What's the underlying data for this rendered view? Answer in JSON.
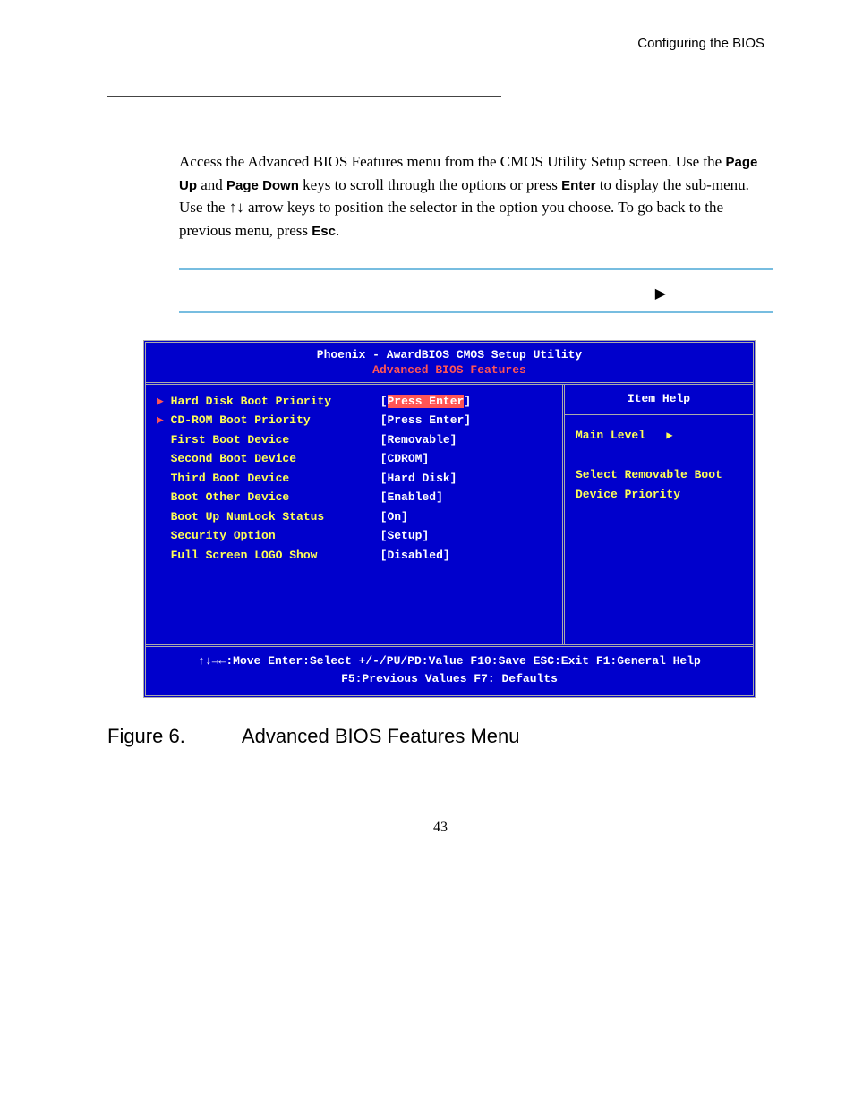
{
  "header": {
    "section": "Configuring the BIOS"
  },
  "intro": {
    "line1_a": "Access the Advanced BIOS Features menu from the CMOS Utility Setup screen. Use the ",
    "b_pageup": "Page Up",
    "line1_b": " and ",
    "b_pagedown": "Page Down",
    "line1_c": " keys to scroll through the options or press ",
    "b_enter": "Enter",
    "line1_d": " to display the sub-menu. Use the ",
    "arrows": "↑↓",
    "line1_e": " arrow keys to position the selector in the option you choose. To go back to the previous menu, press ",
    "b_esc": "Esc",
    "line1_f": "."
  },
  "note_arrow": "▶",
  "bios": {
    "title": "Phoenix - AwardBIOS CMOS Setup Utility",
    "subtitle": "Advanced BIOS Features",
    "rows": [
      {
        "marker": "▶ ",
        "label": "Hard Disk Boot Priority",
        "pad": 32,
        "value": "[Press Enter]",
        "hl": true
      },
      {
        "marker": "▶ ",
        "label": "CD-ROM Boot Priority",
        "pad": 32,
        "value": "[Press Enter]"
      },
      {
        "marker": "  ",
        "label": "First Boot Device",
        "pad": 32,
        "value": "[Removable]"
      },
      {
        "marker": "  ",
        "label": "Second Boot Device",
        "pad": 32,
        "value": "[CDROM]"
      },
      {
        "marker": "  ",
        "label": "Third Boot Device",
        "pad": 32,
        "value": "[Hard Disk]"
      },
      {
        "marker": "  ",
        "label": "Boot Other Device",
        "pad": 32,
        "value": "[Enabled]"
      },
      {
        "marker": "  ",
        "label": "Boot Up NumLock Status",
        "pad": 32,
        "value": "[On]"
      },
      {
        "marker": "  ",
        "label": "Security Option",
        "pad": 32,
        "value": "[Setup]"
      },
      {
        "marker": "  ",
        "label": "Full Screen LOGO Show",
        "pad": 32,
        "value": "[Disabled]"
      }
    ],
    "help": {
      "title": "Item Help",
      "main_level": "Main Level",
      "tri": "▶",
      "help1": "Select Removable Boot",
      "help2": "Device Priority"
    },
    "footer1": "↑↓→←:Move  Enter:Select  +/-/PU/PD:Value  F10:Save  ESC:Exit  F1:General Help",
    "footer2": "F5:Previous Values     F7: Defaults"
  },
  "figure": {
    "num": "Figure 6.",
    "title": "Advanced BIOS Features Menu"
  },
  "page_number": "43"
}
